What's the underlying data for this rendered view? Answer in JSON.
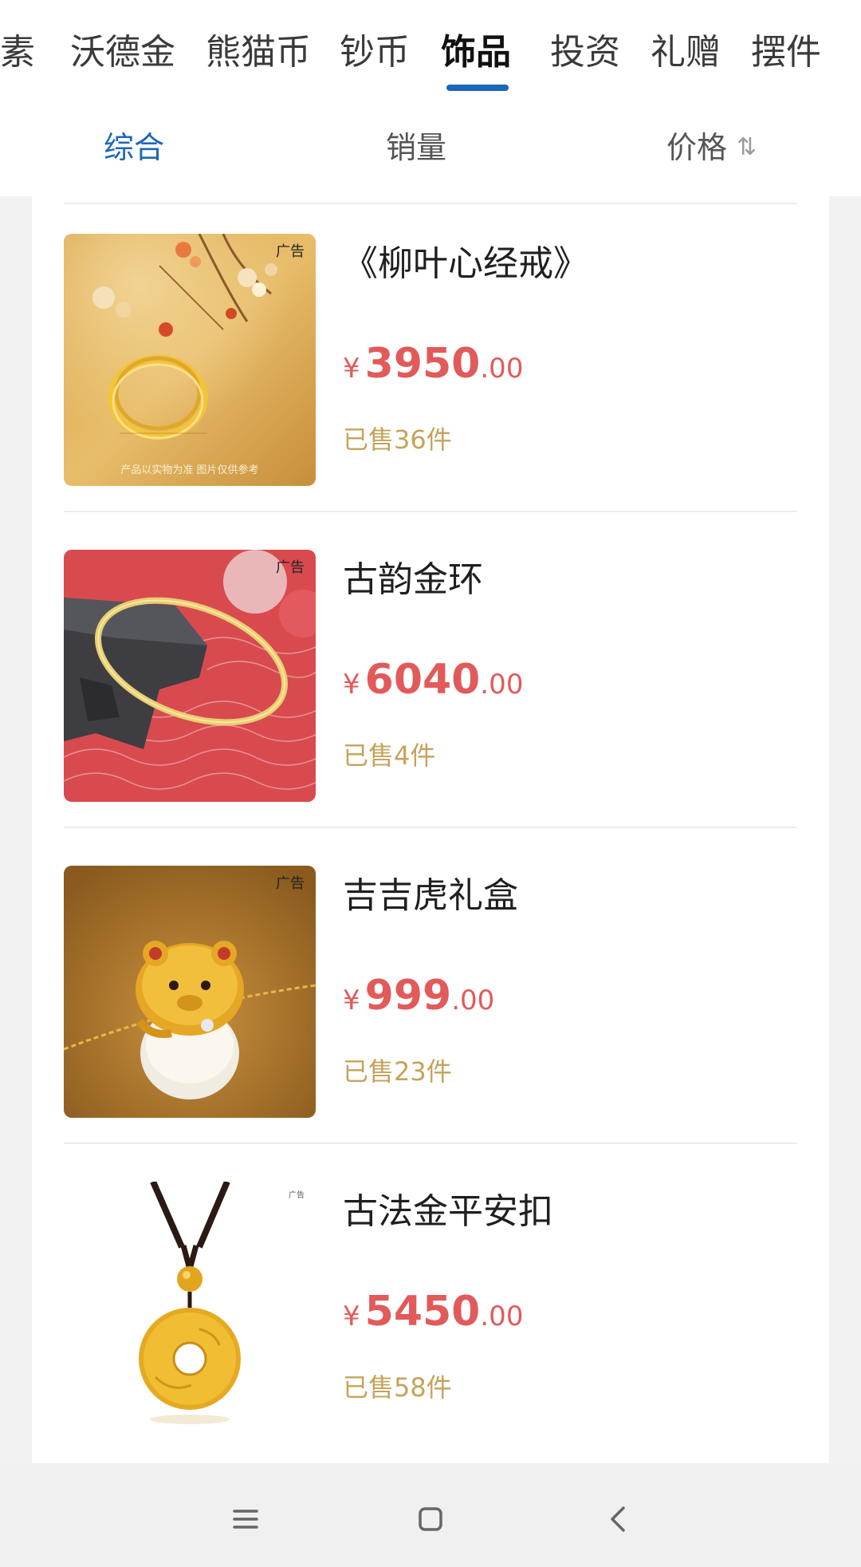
{
  "category_tabs": [
    "素",
    "沃德金",
    "熊猫币",
    "钞币",
    "饰品",
    "投资",
    "礼赠",
    "摆件"
  ],
  "active_category": "饰品",
  "sort": {
    "items": [
      "综合",
      "销量",
      "价格"
    ],
    "active": "综合",
    "price_sort_icon": "sort-arrows-icon"
  },
  "products": [
    {
      "name": "《柳叶心经戒》",
      "currency": "¥",
      "price_int": "3950",
      "price_dec": ".00",
      "sold": "已售36件",
      "ad": "广告",
      "image_caption": "产品以实物为准  图片仅供参考"
    },
    {
      "name": "古韵金环",
      "currency": "¥",
      "price_int": "6040",
      "price_dec": ".00",
      "sold": "已售4件",
      "ad": "广告"
    },
    {
      "name": "吉吉虎礼盒",
      "currency": "¥",
      "price_int": "999",
      "price_dec": ".00",
      "sold": "已售23件",
      "ad": "广告"
    },
    {
      "name": "古法金平安扣",
      "currency": "¥",
      "price_int": "5450",
      "price_dec": ".00",
      "sold": "已售58件",
      "ad": "广告"
    }
  ],
  "navbar": {
    "icons": [
      "menu-icon",
      "home-icon",
      "back-icon"
    ]
  },
  "colors": {
    "accent": "#1d66b8",
    "price": "#e25a5a",
    "sold": "#c5a35a",
    "gold": "#e6b83a"
  }
}
